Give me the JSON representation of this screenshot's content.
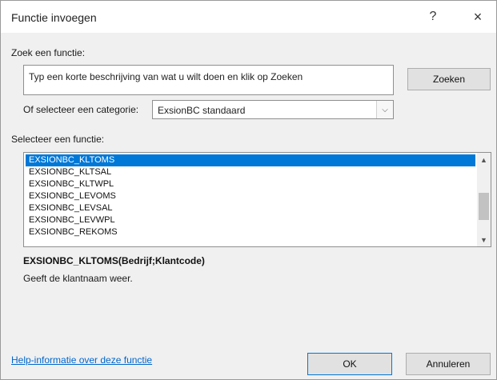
{
  "window": {
    "title": "Functie invoegen",
    "help_glyph": "?",
    "close_glyph": "×"
  },
  "search": {
    "label": "Zoek een functie:",
    "input_value": "Typ een korte beschrijving van wat u wilt doen en klik op Zoeken",
    "button_label": "Zoeken"
  },
  "category": {
    "label": "Of selecteer een categorie:",
    "selected": "ExsionBC standaard"
  },
  "function_list": {
    "label": "Selecteer een functie:",
    "items": [
      "EXSIONBC_KLTOMS",
      "EXSIONBC_KLTSAL",
      "EXSIONBC_KLTWPL",
      "EXSIONBC_LEVOMS",
      "EXSIONBC_LEVSAL",
      "EXSIONBC_LEVWPL",
      "EXSIONBC_REKOMS"
    ],
    "selected_index": 0
  },
  "details": {
    "signature": "EXSIONBC_KLTOMS(Bedrijf;Klantcode)",
    "description": "Geeft de klantnaam weer."
  },
  "footer": {
    "help_link": "Help-informatie over deze functie",
    "ok_label": "OK",
    "cancel_label": "Annuleren"
  },
  "colors": {
    "selection": "#0078d7",
    "link": "#0066cc"
  },
  "icons": {
    "dropdown": "chevron-down-icon",
    "scroll_up": "chevron-up-icon",
    "scroll_down": "chevron-down-icon"
  }
}
